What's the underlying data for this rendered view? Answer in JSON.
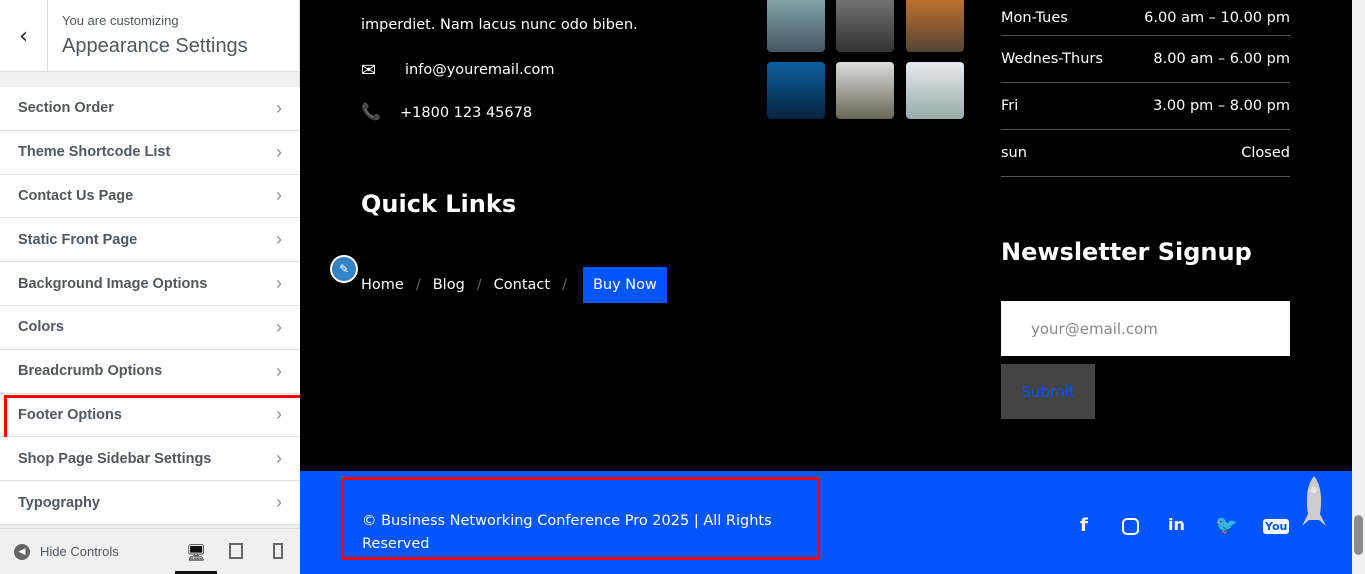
{
  "sidebar": {
    "back": "‹",
    "subtitle": "You are customizing",
    "title": "Appearance Settings",
    "items": [
      {
        "label": "Section Order"
      },
      {
        "label": "Theme Shortcode List"
      },
      {
        "label": "Contact Us Page"
      },
      {
        "label": "Static Front Page"
      },
      {
        "label": "Background Image Options"
      },
      {
        "label": "Colors"
      },
      {
        "label": "Breadcrumb Options"
      },
      {
        "label": "Footer Options"
      },
      {
        "label": "Shop Page Sidebar Settings"
      },
      {
        "label": "Typography"
      }
    ],
    "highlighted": "Footer Options",
    "hide_controls": "Hide Controls",
    "active_device": "desktop"
  },
  "main": {
    "about_text": "imperdiet. Nam lacus nunc odo biben.",
    "email": "info@youremail.com",
    "phone": "+1800 123 45678",
    "hours": [
      {
        "day": "Mon-Tues",
        "time": "6.00 am – 10.00 pm"
      },
      {
        "day": "Wednes-Thurs",
        "time": "8.00 am – 6.00 pm"
      },
      {
        "day": "Fri",
        "time": "3.00 pm – 8.00 pm"
      },
      {
        "day": "sun",
        "time": "Closed"
      }
    ],
    "quick_links_title": "Quick Links",
    "links": [
      "Home",
      "Blog",
      "Contact"
    ],
    "buy_now": "Buy Now",
    "newsletter_title": "Newsletter Signup",
    "email_placeholder": "your@email.com",
    "submit": "Submit",
    "copyright": "© Business Networking Conference Pro 2025 | All Rights Reserved",
    "social": [
      "facebook",
      "instagram",
      "linkedin",
      "twitter",
      "youtube"
    ]
  },
  "colors": {
    "accent": "#0055ff",
    "highlight": "#ff0000"
  }
}
